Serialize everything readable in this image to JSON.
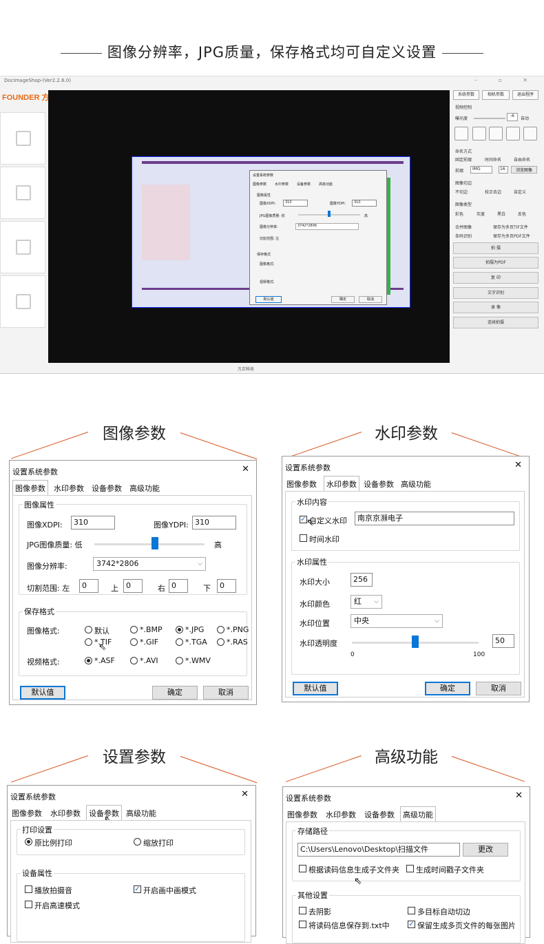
{
  "headline": "图像分辨率，JPG质量，保存格式均可自定义设置",
  "app": {
    "title": "DocImageShop-(Ver2.2.6.0)",
    "logo": "FOUNDER 方正",
    "footer": "方正科技",
    "top_buttons": [
      "系统参数",
      "相机参数",
      "退出程序"
    ],
    "video_ctrl_label": "视频控制",
    "exposure_label": "曝光度",
    "exposure_value": "-6",
    "auto_label": "自动",
    "naming_label": "命名方式",
    "naming_options": [
      "固定前缀",
      "时间命名",
      "自由命名"
    ],
    "prefix_label": "前缀",
    "prefix_value": "IMG",
    "prefix_num": "16",
    "browse_label": "浏览图像",
    "crop_label": "图像切边",
    "crop_options": [
      "不切边",
      "校正去边",
      "自定义"
    ],
    "type_label": "图像类型",
    "type_options": [
      "彩色",
      "灰度",
      "黑白",
      "反色"
    ],
    "checks": [
      "合并图像",
      "保存为多页TIF文件",
      "条码识别",
      "保存为多页PDF文件"
    ],
    "action_buttons": [
      "拍 摄",
      "拍摄为PDF",
      "复 印",
      "文字识别",
      "录 像",
      "连续拍摄"
    ]
  },
  "mini_dialog": {
    "title": "设置系统参数",
    "tabs": [
      "图像参数",
      "水印参数",
      "设备参数",
      "高级功能"
    ],
    "group": "图像属性",
    "xdpi_label": "图像XDPI:",
    "xdpi": "310",
    "ydpi_label": "图像YDPI:",
    "ydpi": "310",
    "jpg_label": "JPG图像质量: 低",
    "high": "高",
    "res_label": "图像分辨率:",
    "res": "3742*2806",
    "crop_label": "切割范围: 左",
    "save_group": "保存格式",
    "format_label": "图像格式:",
    "video_label": "视频格式:",
    "default_btn": "默认值",
    "ok_btn": "确定",
    "cancel_btn": "取消"
  },
  "sections": {
    "image": "图像参数",
    "watermark": "水印参数",
    "settings": "设置参数",
    "advanced": "高级功能"
  },
  "dlg_common": {
    "title": "设置系统参数",
    "close": "✕",
    "tabs": [
      "图像参数",
      "水印参数",
      "设备参数",
      "高级功能"
    ],
    "default_btn": "默认值",
    "ok_btn": "确定",
    "cancel_btn": "取消"
  },
  "image_dlg": {
    "group_attr": "图像属性",
    "xdpi_label": "图像XDPI:",
    "xdpi": "310",
    "ydpi_label": "图像YDPI:",
    "ydpi": "310",
    "jpg_label": "JPG图像质量: 低",
    "jpg_high": "高",
    "jpg_quality_pct": 55,
    "res_label": "图像分辨率:",
    "res_value": "3742*2806",
    "crop_label": "切割范围: 左",
    "crop_left": "0",
    "crop_top_label": "上",
    "crop_top": "0",
    "crop_right_label": "右",
    "crop_right": "0",
    "crop_bottom_label": "下",
    "crop_bottom": "0",
    "group_save": "保存格式",
    "img_format_label": "图像格式:",
    "img_formats": [
      "默认",
      "*.BMP",
      "*.JPG",
      "*.PNG",
      "*.TIF",
      "*.GIF",
      "*.TGA",
      "*.RAS"
    ],
    "img_format_selected": "*.JPG",
    "video_format_label": "视频格式:",
    "video_formats": [
      "*.ASF",
      "*.AVI",
      "*.WMV"
    ],
    "video_format_selected": "*.ASF"
  },
  "wm_dlg": {
    "group_content": "水印内容",
    "custom_label": "自定义水印",
    "custom_checked": true,
    "custom_value": "南京京瀕电子",
    "time_label": "时间水印",
    "group_attr": "水印属性",
    "size_label": "水印大小",
    "size_value": "256",
    "color_label": "水印颜色",
    "color_value": "红",
    "pos_label": "水印位置",
    "pos_value": "中央",
    "opacity_label": "水印透明度",
    "opacity_value": "50",
    "opacity_min": "0",
    "opacity_max": "100"
  },
  "dev_dlg": {
    "group_print": "打印设置",
    "print_ratio": "原比例打印",
    "print_scale": "缩放打印",
    "group_dev": "设备属性",
    "sound": "播放拍摄音",
    "pip": "开启画中画模式",
    "highspeed": "开启高速模式"
  },
  "adv_dlg": {
    "group_path": "存储路径",
    "path_value": "C:\\Users\\Lenovo\\Desktop\\扫描文件",
    "change_btn": "更改",
    "sub_by_code": "根据读码信息生成子文件夹",
    "sub_by_time": "生成时间戳子文件夹",
    "group_other": "其他设置",
    "deshadow": "去阴影",
    "multi_crop": "多目标自动切边",
    "save_code_txt": "将读码信息保存到.txt中",
    "keep_each": "保留生成多页文件的每张图片"
  }
}
